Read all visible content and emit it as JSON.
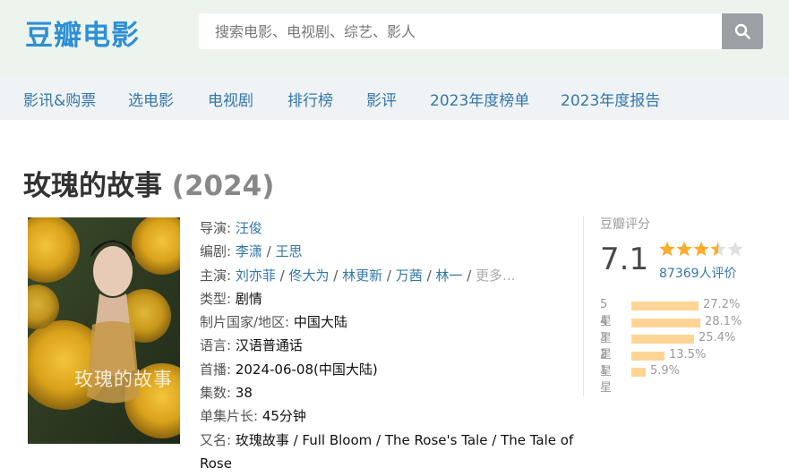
{
  "header": {
    "logo": "豆瓣电影",
    "search_placeholder": "搜索电影、电视剧、综艺、影人"
  },
  "nav": [
    "影讯&购票",
    "选电影",
    "电视剧",
    "排行榜",
    "影评",
    "2023年度榜单",
    "2023年度报告"
  ],
  "movie": {
    "title": "玫瑰的故事",
    "year": "(2024)",
    "poster_text": "玫瑰的故事"
  },
  "info": {
    "director_label": "导演:",
    "director": "汪俊",
    "writer_label": "编剧:",
    "writers": [
      "李潇",
      "王思"
    ],
    "cast_label": "主演:",
    "cast": [
      "刘亦菲",
      "佟大为",
      "林更新",
      "万茜",
      "林一"
    ],
    "cast_more": "更多...",
    "genre_label": "类型:",
    "genre": "剧情",
    "country_label": "制片国家/地区:",
    "country": "中国大陆",
    "language_label": "语言:",
    "language": "汉语普通话",
    "premiere_label": "首播:",
    "premiere": "2024-06-08(中国大陆)",
    "episodes_label": "集数:",
    "episodes": "38",
    "runtime_label": "单集片长:",
    "runtime": "45分钟",
    "aka_label": "又名:",
    "aka": "玫瑰故事 / Full Bloom / The Rose's Tale / The Tale of Rose"
  },
  "rating": {
    "label": "豆瓣评分",
    "score": "7.1",
    "stars": 3.5,
    "votes": "87369人评价",
    "distribution": [
      {
        "label": "5星",
        "pct": "27.2%",
        "value": 27.2
      },
      {
        "label": "4星",
        "pct": "28.1%",
        "value": 28.1
      },
      {
        "label": "3星",
        "pct": "25.4%",
        "value": 25.4
      },
      {
        "label": "2星",
        "pct": "13.5%",
        "value": 13.5
      },
      {
        "label": "1星",
        "pct": "5.9%",
        "value": 5.9
      }
    ]
  },
  "colors": {
    "link": "#3377aa",
    "logo": "#2e8fd6",
    "star": "#ffac2d",
    "bar": "#ffd596"
  }
}
